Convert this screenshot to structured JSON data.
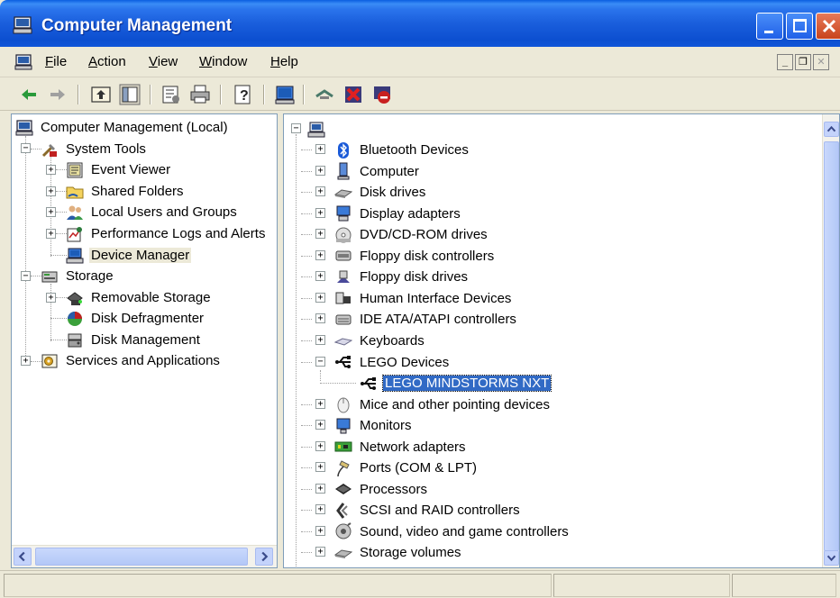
{
  "window": {
    "title": "Computer Management",
    "colors": {
      "title_bar": "#1a5edc",
      "selection": "#316ac5",
      "chrome": "#ece9d8"
    }
  },
  "menu": {
    "items": [
      {
        "label": "File"
      },
      {
        "label": "Action"
      },
      {
        "label": "View"
      },
      {
        "label": "Window"
      },
      {
        "label": "Help"
      }
    ]
  },
  "toolbar": {
    "buttons": [
      {
        "icon": "back-arrow-icon"
      },
      {
        "icon": "forward-arrow-icon"
      },
      {
        "icon": "up-folder-icon"
      },
      {
        "icon": "show-hide-tree-icon"
      },
      {
        "icon": "properties-icon"
      },
      {
        "icon": "print-icon"
      },
      {
        "icon": "help-icon"
      },
      {
        "icon": "scan-hardware-icon"
      },
      {
        "icon": "update-driver-icon"
      },
      {
        "icon": "uninstall-icon"
      },
      {
        "icon": "disable-device-icon"
      }
    ]
  },
  "left_tree": {
    "root": "Computer Management (Local)",
    "system_tools": "System Tools",
    "event_viewer": "Event Viewer",
    "shared_folders": "Shared Folders",
    "local_users": "Local Users and Groups",
    "perf_logs": "Performance Logs and Alerts",
    "device_manager": "Device Manager",
    "storage": "Storage",
    "removable_storage": "Removable Storage",
    "disk_defrag": "Disk Defragmenter",
    "disk_mgmt": "Disk Management",
    "services": "Services and Applications"
  },
  "device_tree": {
    "categories": [
      {
        "label": "Bluetooth Devices",
        "icon": "bluetooth-icon"
      },
      {
        "label": "Computer",
        "icon": "computer-icon"
      },
      {
        "label": "Disk drives",
        "icon": "disk-drive-icon"
      },
      {
        "label": "Display adapters",
        "icon": "display-adapter-icon"
      },
      {
        "label": "DVD/CD-ROM drives",
        "icon": "cdrom-icon"
      },
      {
        "label": "Floppy disk controllers",
        "icon": "controller-icon"
      },
      {
        "label": "Floppy disk drives",
        "icon": "floppy-icon"
      },
      {
        "label": "Human Interface Devices",
        "icon": "hid-icon"
      },
      {
        "label": "IDE ATA/ATAPI controllers",
        "icon": "ide-controller-icon"
      },
      {
        "label": "Keyboards",
        "icon": "keyboard-icon"
      },
      {
        "label": "LEGO Devices",
        "icon": "usb-icon"
      },
      {
        "label": "LEGO MINDSTORMS NXT",
        "icon": "usb-icon"
      },
      {
        "label": "Mice and other pointing devices",
        "icon": "mouse-icon"
      },
      {
        "label": "Monitors",
        "icon": "monitor-icon"
      },
      {
        "label": "Network adapters",
        "icon": "network-adapter-icon"
      },
      {
        "label": "Ports (COM & LPT)",
        "icon": "port-icon"
      },
      {
        "label": "Processors",
        "icon": "processor-icon"
      },
      {
        "label": "SCSI and RAID controllers",
        "icon": "scsi-icon"
      },
      {
        "label": "Sound, video and game controllers",
        "icon": "sound-icon"
      },
      {
        "label": "Storage volumes",
        "icon": "storage-volume-icon"
      }
    ]
  }
}
